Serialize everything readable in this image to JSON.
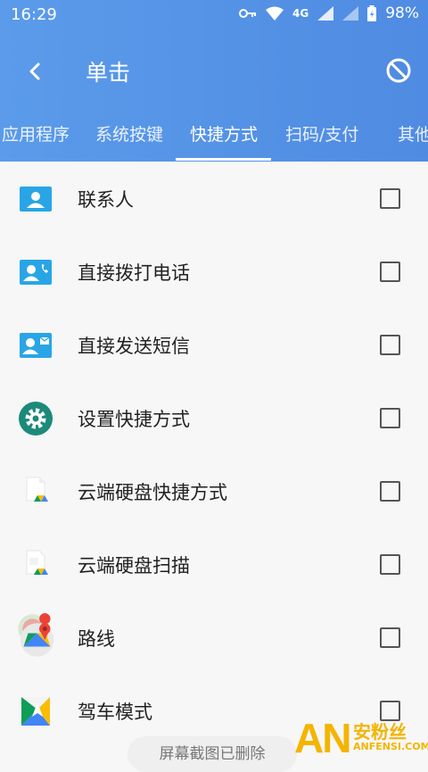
{
  "status_bar": {
    "time": "16:29",
    "network": "4G",
    "battery": "98%"
  },
  "toolbar": {
    "title": "单击",
    "back_icon": "chevron-left-icon",
    "action_icon": "block-icon"
  },
  "tabs": [
    {
      "label": "应用程序",
      "active": false
    },
    {
      "label": "系统按键",
      "active": false
    },
    {
      "label": "快捷方式",
      "active": true
    },
    {
      "label": "扫码/支付",
      "active": false
    },
    {
      "label": "其他",
      "active": false
    }
  ],
  "items": [
    {
      "label": "联系人",
      "icon": "contact-card-icon",
      "checked": false
    },
    {
      "label": "直接拨打电话",
      "icon": "contact-phone-icon",
      "checked": false
    },
    {
      "label": "直接发送短信",
      "icon": "contact-mail-icon",
      "checked": false
    },
    {
      "label": "设置快捷方式",
      "icon": "settings-gear-icon",
      "checked": false
    },
    {
      "label": "云端硬盘快捷方式",
      "icon": "drive-file-icon",
      "checked": false
    },
    {
      "label": "云端硬盘扫描",
      "icon": "drive-scan-icon",
      "checked": false
    },
    {
      "label": "路线",
      "icon": "maps-icon",
      "checked": false
    },
    {
      "label": "驾车模式",
      "icon": "driving-mode-icon",
      "checked": false
    }
  ],
  "toast": "屏幕截图已删除",
  "watermark": {
    "logo": "AN",
    "cn": "安粉丝",
    "en": "ANFENSI.COM"
  },
  "colors": {
    "header": "#5b9bea",
    "contact_icon": "#29a5e6",
    "settings_icon": "#1c8a7a"
  }
}
